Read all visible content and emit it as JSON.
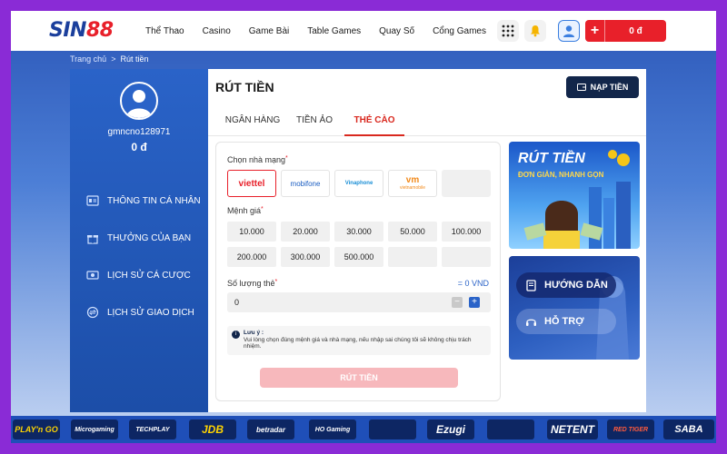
{
  "header": {
    "logo_text": "SIN",
    "logo_accent": "88",
    "nav": [
      "Thể Thao",
      "Casino",
      "Game Bài",
      "Table Games",
      "Quay Số",
      "Cổng Games"
    ],
    "balance_plus": "+",
    "balance": "0 đ"
  },
  "breadcrumb": {
    "home": "Trang chủ",
    "separator": ">",
    "current": "Rút tiền"
  },
  "sidebar": {
    "username": "gmncno128971",
    "balance": "0 đ",
    "items": [
      {
        "label": "THÔNG TIN CÁ NHÂN",
        "icon": "id-card-icon"
      },
      {
        "label": "THƯỞNG CỦA BẠN",
        "icon": "gift-icon"
      },
      {
        "label": "LỊCH SỬ CÁ CƯỢC",
        "icon": "ticket-icon"
      },
      {
        "label": "LỊCH SỬ GIAO DỊCH",
        "icon": "transaction-icon"
      }
    ]
  },
  "main": {
    "title": "RÚT TIỀN",
    "deposit_label": "NẠP TIỀN",
    "tabs": [
      {
        "label": "NGÂN HÀNG",
        "active": false
      },
      {
        "label": "TIỀN ẢO",
        "active": false
      },
      {
        "label": "THẺ CÀO",
        "active": true
      }
    ],
    "form": {
      "carrier_label": "Chọn nhà mạng",
      "carriers": [
        {
          "name": "viettel",
          "color": "#e8202a",
          "selected": true
        },
        {
          "name": "mobifone",
          "color": "#1b5ec2",
          "selected": false
        },
        {
          "name": "Vinaphone",
          "color": "#1b8fd6",
          "selected": false
        },
        {
          "name": "vietnamobile",
          "color": "#f28a1c",
          "selected": false
        },
        {
          "name": "",
          "color": "",
          "selected": false
        }
      ],
      "denom_label": "Mệnh giá",
      "denominations": [
        "10.000",
        "20.000",
        "30.000",
        "50.000",
        "100.000",
        "200.000",
        "300.000",
        "500.000",
        "",
        ""
      ],
      "qty_label": "Số lượng thẻ",
      "qty_total": "= 0 VND",
      "qty_value": "0",
      "minus": "−",
      "plus": "+",
      "note_title": "Lưu ý :",
      "note_text": "Vui lòng chọn đúng mệnh giá và nhà mạng, nếu nhập sai chúng tôi sẽ không chịu trách nhiệm.",
      "submit_label": "RÚT TIỀN"
    },
    "promo": {
      "title": "RÚT TIỀN",
      "subtitle": "ĐƠN GIẢN, NHANH GỌN"
    },
    "help": {
      "guide_label": "HƯỚNG DẪN",
      "support_label": "HỖ TRỢ"
    }
  },
  "partners": [
    "PLAY'n GO",
    "Microgaming",
    "TECHPLAY",
    "JDB",
    "betradar",
    "HO Gaming",
    "",
    "Ezugi",
    "",
    "NETENT",
    "RED TIGER",
    "SABA"
  ],
  "colors": {
    "brand_blue": "#1b3f9c",
    "brand_red": "#e8202a",
    "sidebar_blue": "#2a63c8",
    "dark_navy": "#12264a"
  }
}
